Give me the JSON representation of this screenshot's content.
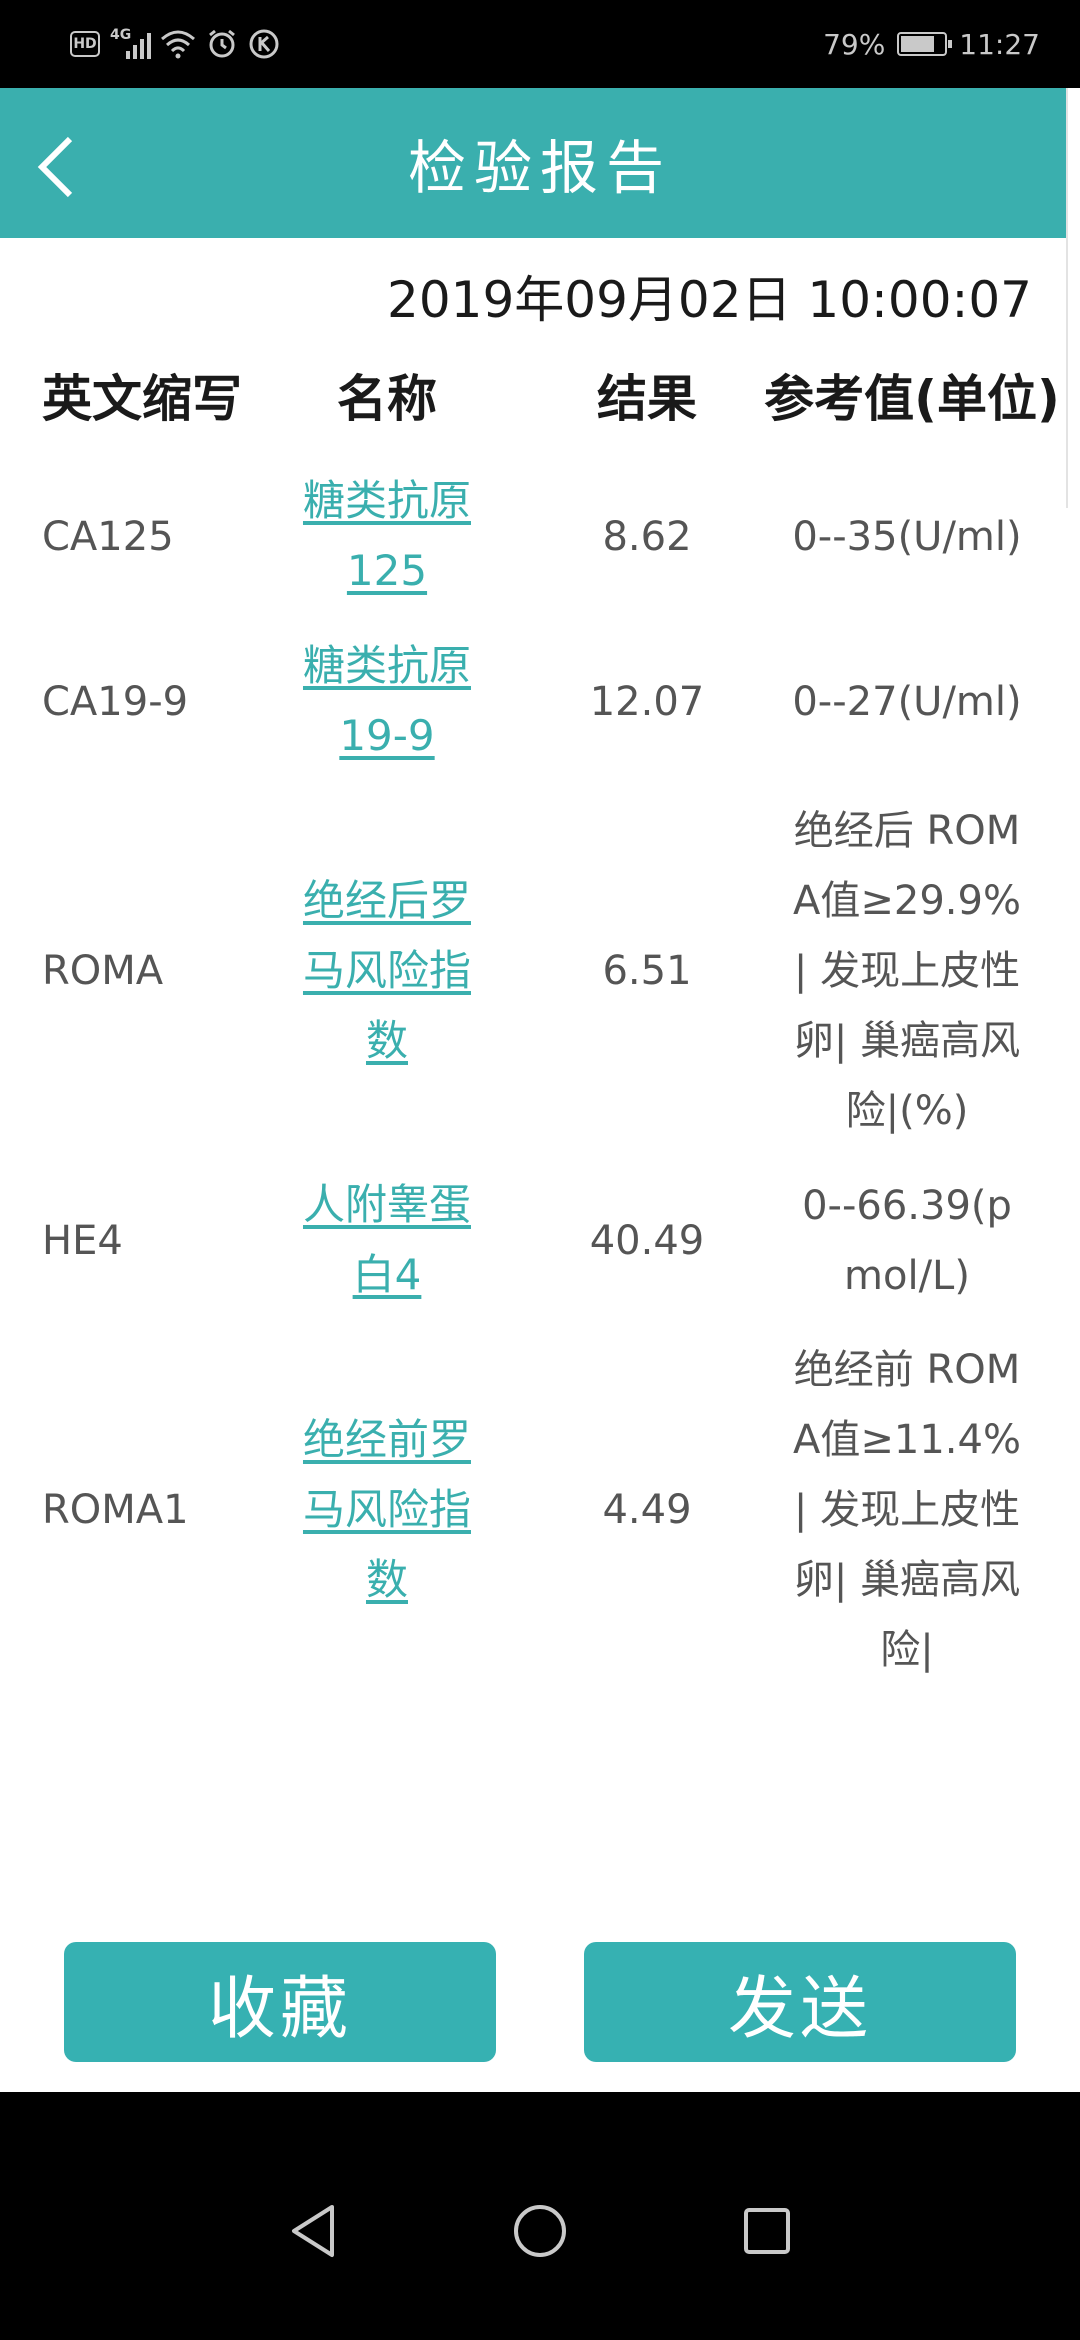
{
  "status_bar": {
    "hd_label": "HD",
    "network_label": "4G",
    "battery_percent": "79%",
    "battery_level": 0.79,
    "time": "11:27"
  },
  "header": {
    "title": "检验报告",
    "back_icon": "chevron-left-icon"
  },
  "report": {
    "datetime": "2019年09月02日 10:00:07",
    "columns": {
      "abbr": "英文缩写",
      "name": "名称",
      "result": "结果",
      "reference": "参考值(单位)"
    },
    "rows": [
      {
        "abbr": "CA125",
        "name": "糖类抗原125",
        "result": "8.62",
        "reference": "0--35(U/ml)"
      },
      {
        "abbr": "CA19-9",
        "name": "糖类抗原19-9",
        "result": "12.07",
        "reference": "0--27(U/ml)"
      },
      {
        "abbr": "ROMA",
        "name": "绝经后罗马风险指数",
        "result": "6.51",
        "reference": "绝经后 ROMA值≥29.9%| 发现上皮性卵| 巢癌高风险|(%)"
      },
      {
        "abbr": "HE4",
        "name": "人附睾蛋白4",
        "result": "40.49",
        "reference": "0--66.39(pmol/L)"
      },
      {
        "abbr": "ROMA1",
        "name": "绝经前罗马风险指数",
        "result": "4.49",
        "reference": "绝经前 ROMA值≥11.4%| 发现上皮性卵| 巢癌高风险|"
      }
    ]
  },
  "actions": {
    "favorite_label": "收藏",
    "send_label": "发送"
  },
  "colors": {
    "accent": "#3aafae",
    "button": "#36b1b2"
  }
}
